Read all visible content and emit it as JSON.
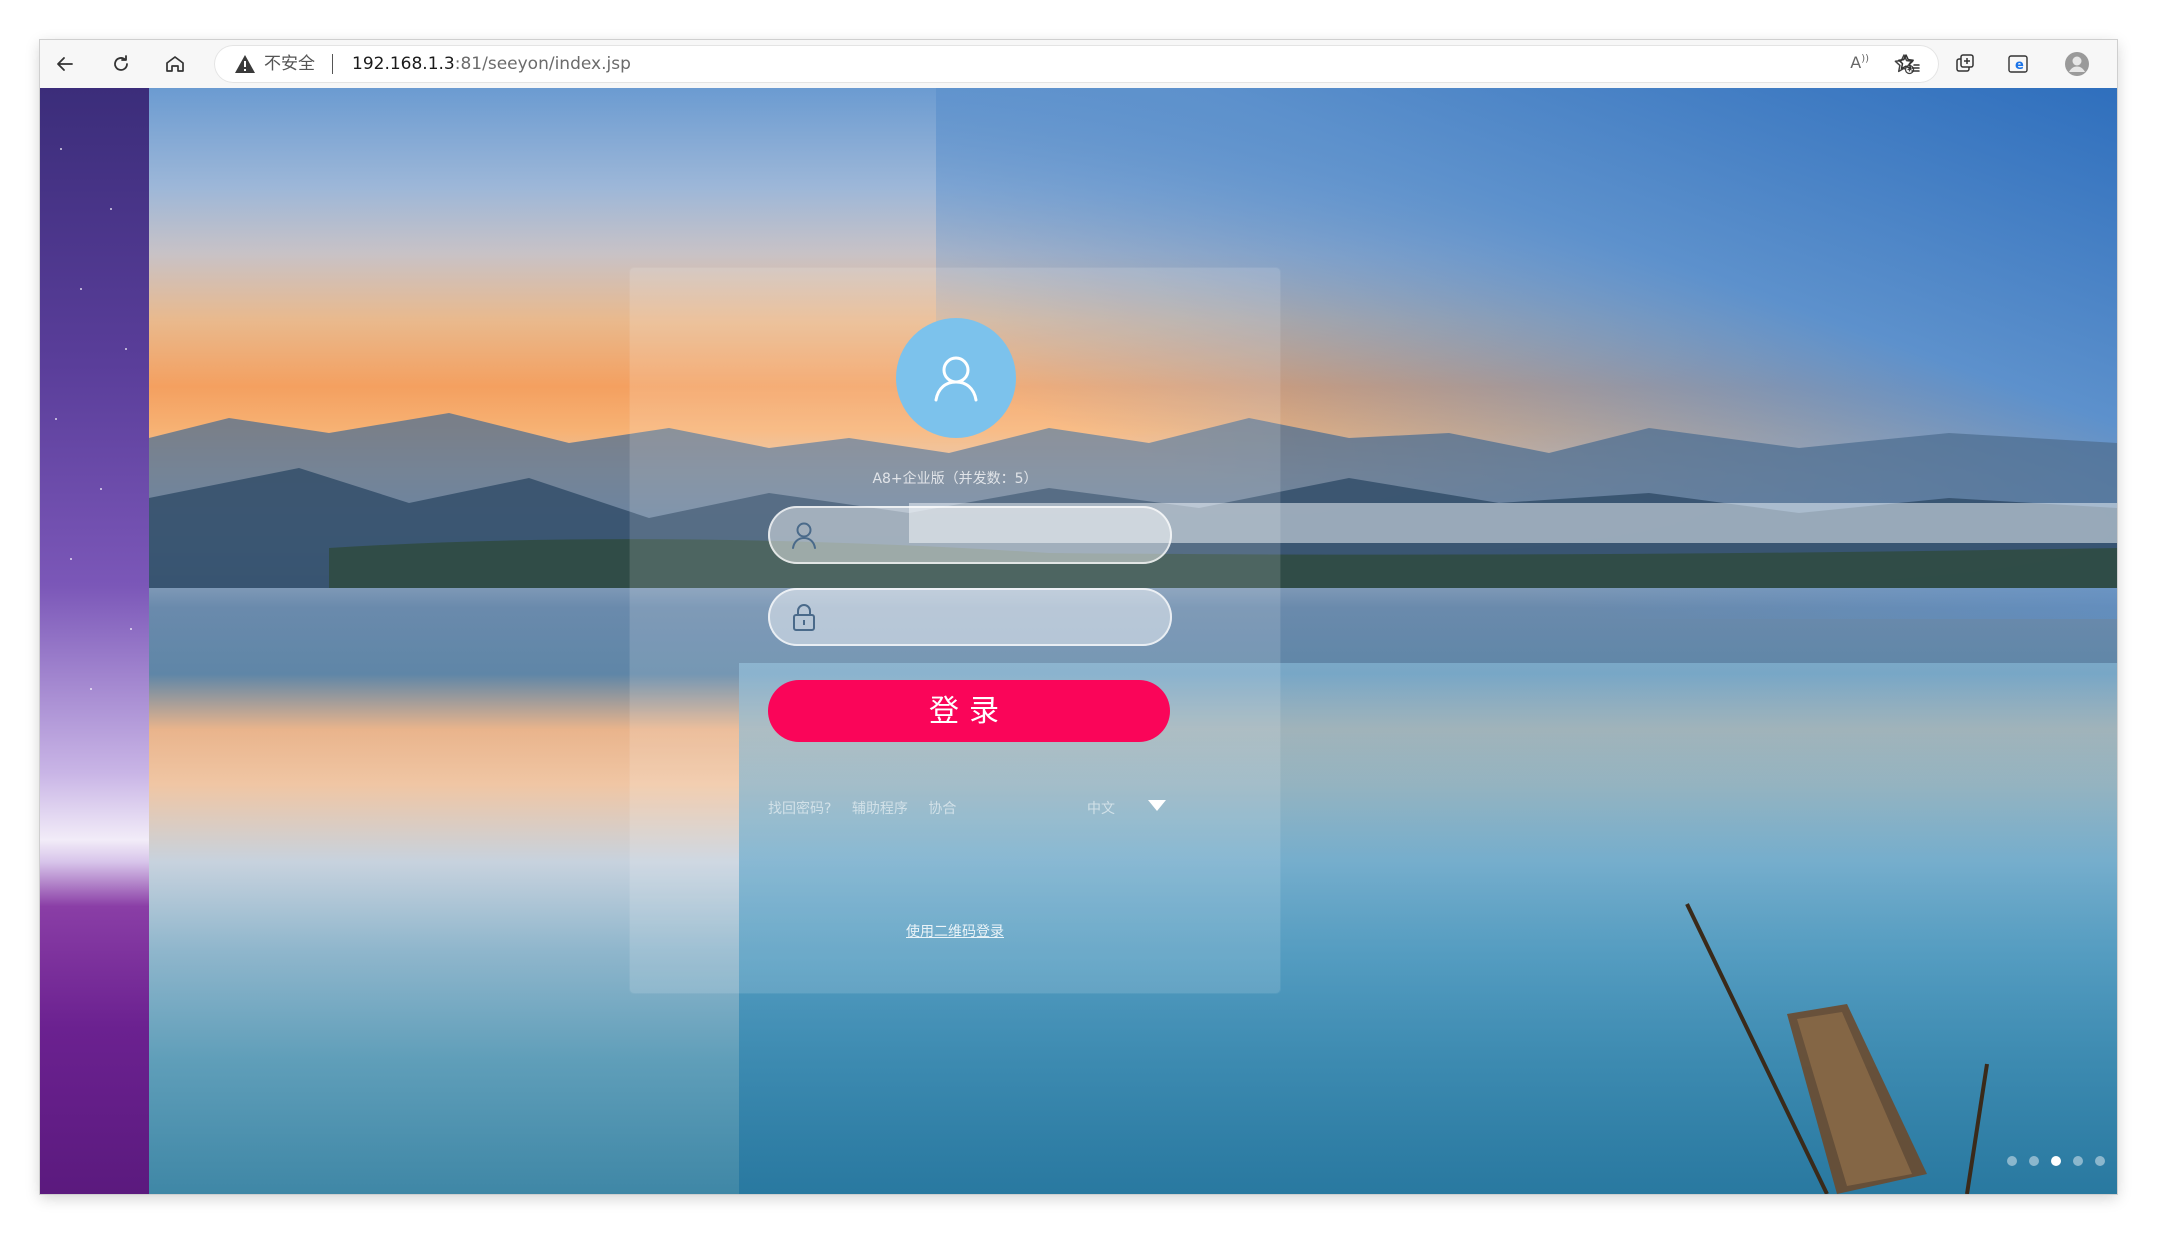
{
  "browser": {
    "security_label": "不安全",
    "url_host": "192.168.1.3",
    "url_rest": ":81/seeyon/index.jsp",
    "read_aloud_label": "Aᵃ"
  },
  "login": {
    "edition": "A8+企业版（并发数：5）",
    "username_placeholder": "",
    "password_placeholder": "",
    "login_label": "登录",
    "links": [
      "找回密码?",
      "辅助程序",
      "协合"
    ],
    "language": "中文",
    "qr_login": "使用二维码登录"
  },
  "carousel": {
    "dot_count": 5,
    "active_index": 2
  },
  "colors": {
    "login_button": "#fa0559",
    "avatar": "#7cc2ec"
  }
}
